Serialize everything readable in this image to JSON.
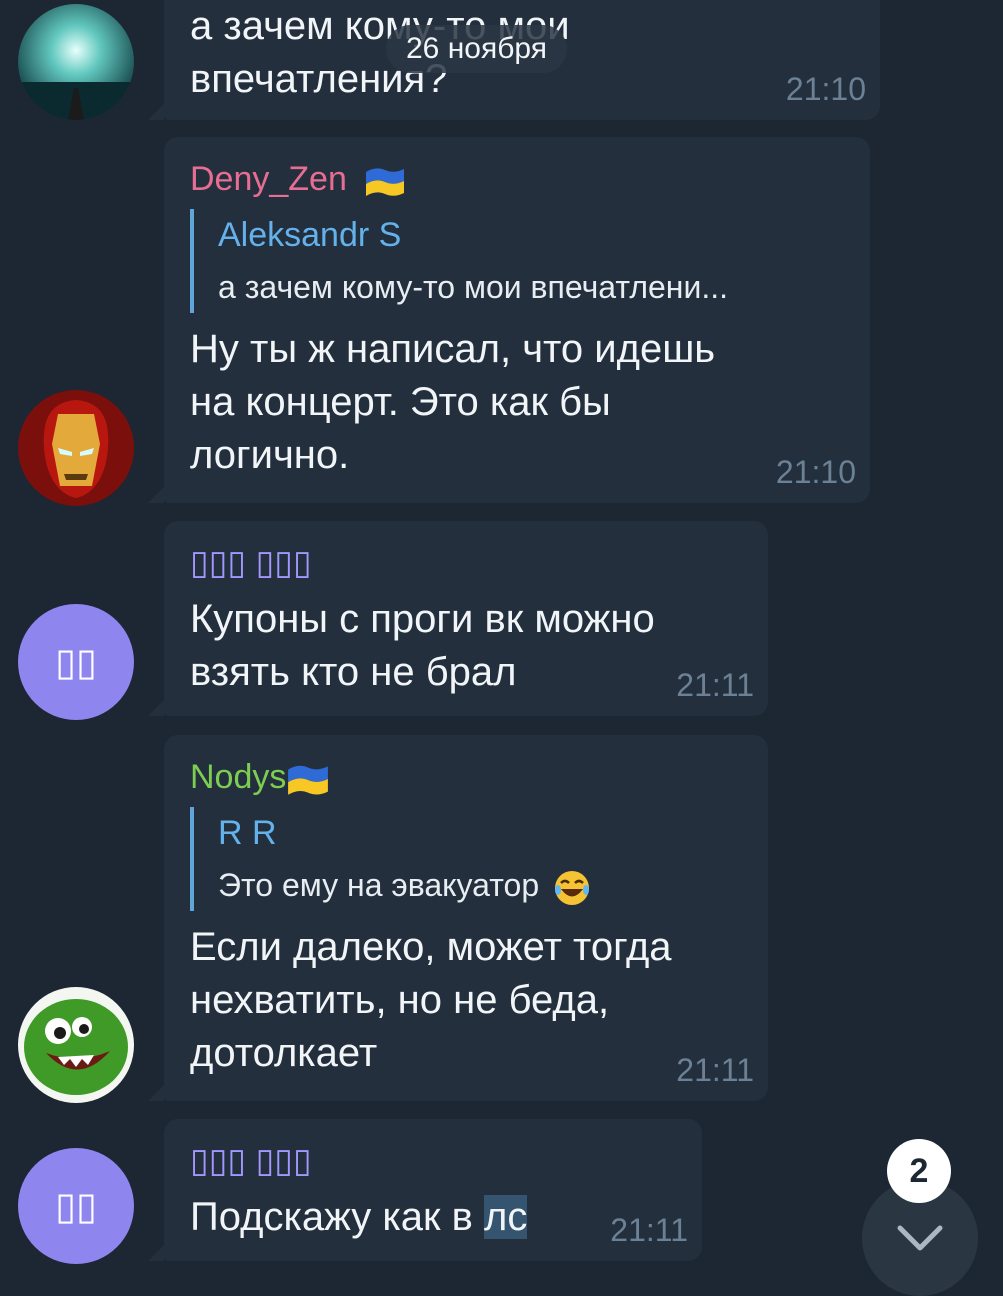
{
  "date_pill": "26 ноября",
  "messages": [
    {
      "text": "а зачем кому-то мои впечатления?",
      "time": "21:10"
    },
    {
      "sender": "Deny_Zen",
      "reply": {
        "name": "Aleksandr S",
        "text": "а зачем кому-то мои впечатлени..."
      },
      "text": "Ну ты ж написал, что идешь на концерт. Это как бы логично.",
      "time": "21:10"
    },
    {
      "sender": "▯▯▯ ▯▯▯",
      "avatar_initials": "▯▯",
      "text": "Купоны с проги вк можно взять кто не брал",
      "time": "21:11"
    },
    {
      "sender": "Nodys",
      "reply": {
        "name": "R R",
        "text": "Это ему на эвакуатор"
      },
      "text": "Если далеко, может тогда нехватить, но не беда, дотолкает",
      "time": "21:11"
    },
    {
      "sender": "▯▯▯ ▯▯▯",
      "avatar_initials": "▯▯",
      "text_before": "Подскажу как в ",
      "text_highlight": "лс",
      "time": "21:11"
    }
  ],
  "scroll_badge": "2",
  "icons": {
    "flag": "ukraine-flag-icon",
    "emoji": "laughing-emoji-icon",
    "scroll": "chevron-down-icon"
  },
  "colors": {
    "background": "#1d2733",
    "bubble": "#232f3d",
    "sender_pink": "#e76e92",
    "sender_purple": "#a297ff",
    "sender_green": "#7ccd51",
    "reply_name": "#64b2eb",
    "time": "#6c8195"
  }
}
